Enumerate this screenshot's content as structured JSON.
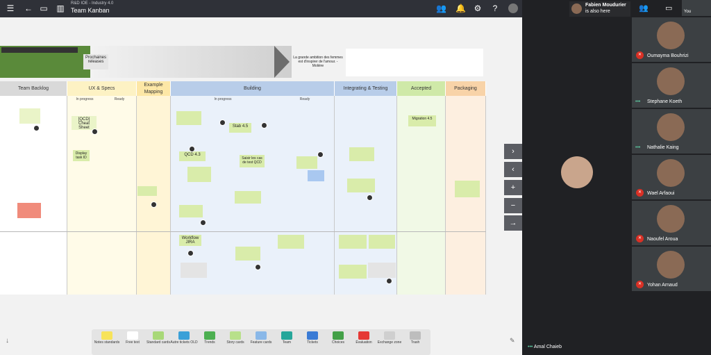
{
  "appbar": {
    "subtitle": "R&D IOE - Industry 4.0",
    "title": "Team Kanban"
  },
  "strip": {
    "prochaines": "Prochaines releases",
    "quote": "La grande ambition des femmes est d'inspirer de l'amour. - Molière"
  },
  "columns": [
    {
      "label": "Team Backlog",
      "color": "#d9d9d9"
    },
    {
      "label": "UX & Specs",
      "color": "#fdf2c4"
    },
    {
      "label": "Example Mapping",
      "color": "#fde7a6"
    },
    {
      "label": "Building",
      "color": "#b8cde9"
    },
    {
      "label": "Integrating & Testing",
      "color": "#b8cde9"
    },
    {
      "label": "Accepted",
      "color": "#cfe9a8"
    },
    {
      "label": "Packaging",
      "color": "#f8d3a8"
    }
  ],
  "subheads": {
    "ux_in": "In progress",
    "ux_ready": "Ready",
    "b_in": "In progress",
    "b_ready": "Ready"
  },
  "cards": {
    "c1": "[QCD] Cheat Sheet",
    "c2": "Display task ID",
    "c3": "QCD 4.3",
    "c4": "Stab 4.5",
    "c5": "Saisir les cas de test QCD",
    "c6": "Workflow JIRA",
    "c7": "Migration 4.5"
  },
  "toolbar": [
    {
      "label": "Notes standards",
      "color": "#f7e35a"
    },
    {
      "label": "Free text",
      "color": "#ffffff"
    },
    {
      "label": "Standard cards",
      "color": "#a8d878"
    },
    {
      "label": "Autre tickets OLD",
      "color": "#3aa0d8"
    },
    {
      "label": "Trends",
      "color": "#4caf50"
    },
    {
      "label": "Story cards",
      "color": "#b8e08a"
    },
    {
      "label": "Feature cards",
      "color": "#8ab8e8"
    },
    {
      "label": "Team",
      "color": "#26a69a"
    },
    {
      "label": "Tickets",
      "color": "#3a7bd5"
    },
    {
      "label": "Choices",
      "color": "#43a047"
    },
    {
      "label": "Évaluation",
      "color": "#e53935"
    },
    {
      "label": "Exchange zone",
      "color": "#cfcfcf"
    },
    {
      "label": "Trash",
      "color": "#bdbdbd"
    }
  ],
  "meet": {
    "presenter_name": "Fabien Moudurier",
    "presenter_note": "is also here",
    "you": "You",
    "speaker": "Amal Chaieb",
    "participants": [
      "Oumayma Bouhrizi",
      "Stephane Koeth",
      "Nathalie Kaing",
      "Wael Arfaoui",
      "Naoufel Aroua",
      "Yohan Arnaud"
    ]
  }
}
